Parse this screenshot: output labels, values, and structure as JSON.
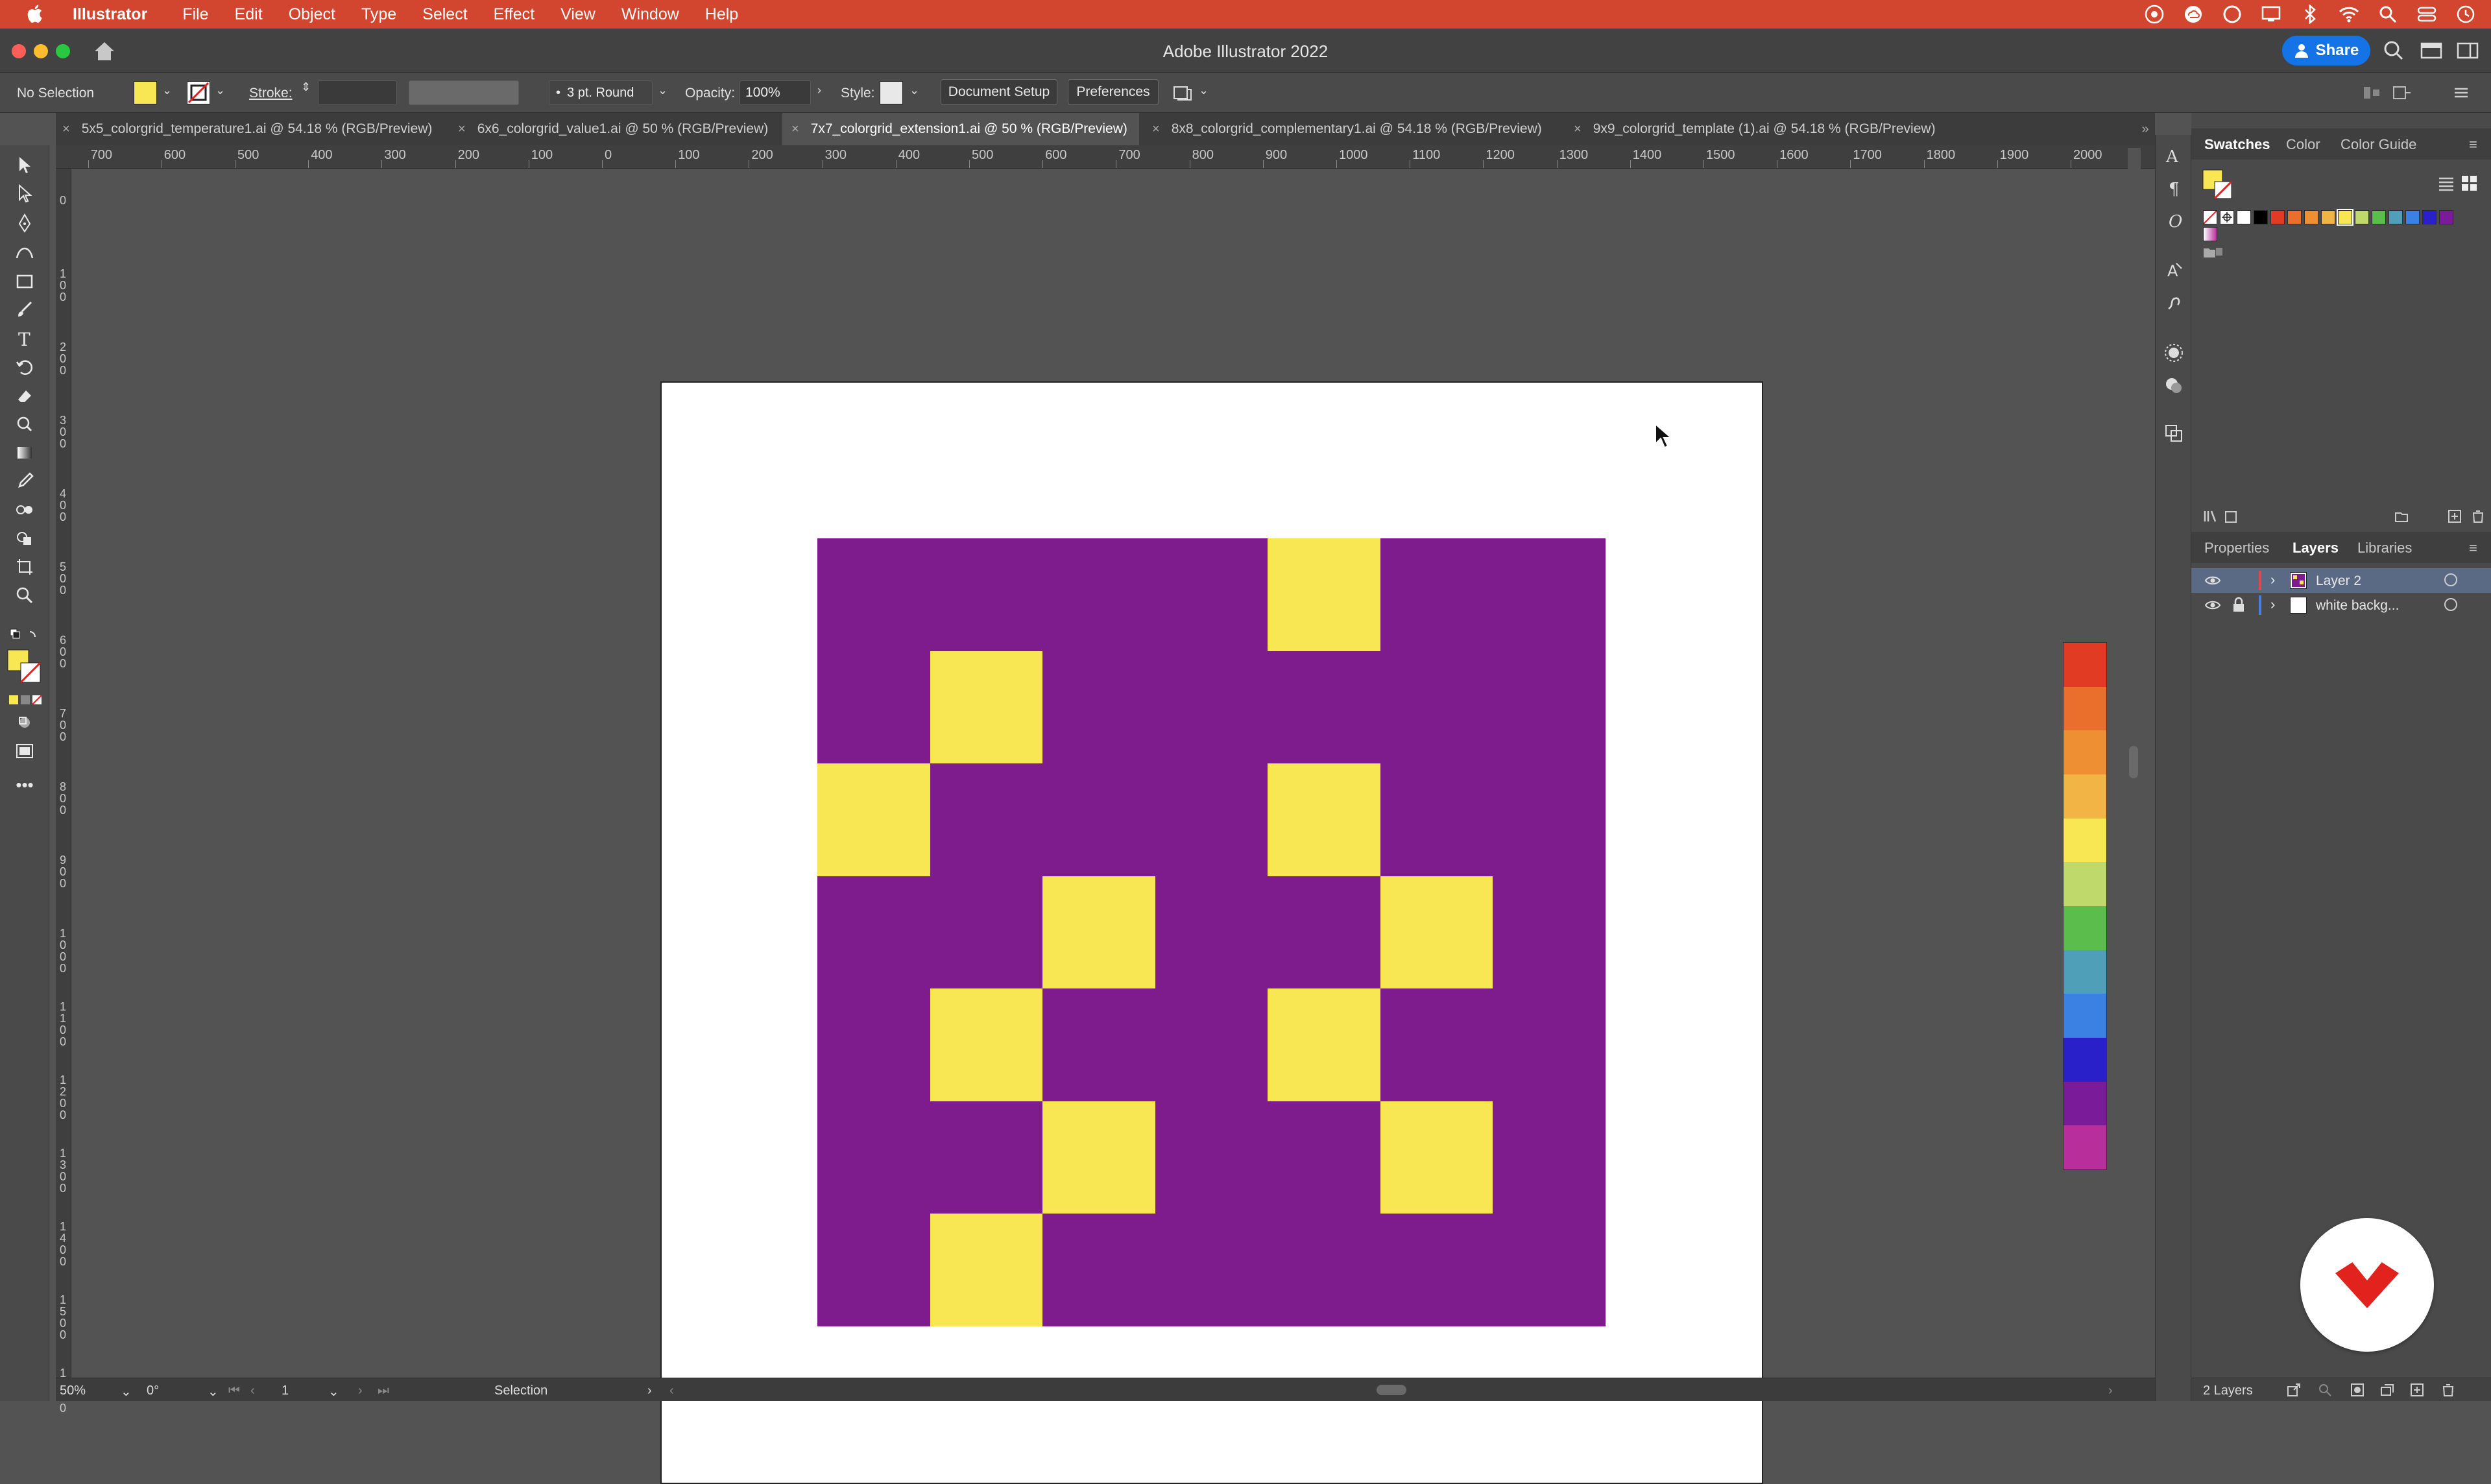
{
  "menubar": {
    "app": "Illustrator",
    "items": [
      "File",
      "Edit",
      "Object",
      "Type",
      "Select",
      "Effect",
      "View",
      "Window",
      "Help"
    ]
  },
  "titlebar": {
    "title": "Adobe Illustrator 2022",
    "share": "Share"
  },
  "control": {
    "selection": "No Selection",
    "fill_color": "#f8e752",
    "stroke_label": "Stroke:",
    "brush": "3 pt. Round",
    "opacity_label": "Opacity:",
    "opacity_value": "100%",
    "style_label": "Style:",
    "document_setup": "Document Setup",
    "preferences": "Preferences"
  },
  "tabs": [
    {
      "label": "5x5_colorgrid_temperature1.ai @ 54.18 % (RGB/Preview)"
    },
    {
      "label": "6x6_colorgrid_value1.ai @ 50 % (RGB/Preview)"
    },
    {
      "label": "7x7_colorgrid_extension1.ai @ 50 % (RGB/Preview)"
    },
    {
      "label": "8x8_colorgrid_complementary1.ai @ 54.18 % (RGB/Preview)"
    },
    {
      "label": "9x9_colorgrid_template (1).ai @ 54.18 % (RGB/Preview)"
    }
  ],
  "ruler_top": [
    "700",
    "600",
    "500",
    "400",
    "300",
    "200",
    "100",
    "0",
    "100",
    "200",
    "300",
    "400",
    "500",
    "600",
    "700",
    "800",
    "900",
    "1000",
    "1100",
    "1200",
    "1300",
    "1400",
    "1500",
    "1600",
    "1700",
    "1800",
    "1900",
    "2000"
  ],
  "ruler_left": [
    "0",
    "100",
    "200",
    "300",
    "400",
    "500",
    "600",
    "700",
    "800",
    "900",
    "1000",
    "1100",
    "1200",
    "1300",
    "1400",
    "1500",
    "1600"
  ],
  "artwork": {
    "grid_size": 7,
    "background": "#7e1b8d",
    "accent": "#f8e752",
    "yellow_cells": [
      [
        0,
        4
      ],
      [
        1,
        1
      ],
      [
        2,
        0
      ],
      [
        2,
        4
      ],
      [
        3,
        2
      ],
      [
        3,
        5
      ],
      [
        4,
        1
      ],
      [
        4,
        4
      ],
      [
        5,
        2
      ],
      [
        5,
        5
      ],
      [
        6,
        1
      ]
    ]
  },
  "colorbar": [
    "#e13b24",
    "#ea6f2c",
    "#ef8f34",
    "#f2b545",
    "#f8e752",
    "#bfd96b",
    "#5bbd4c",
    "#4f9fb9",
    "#3b80e3",
    "#2a20c9",
    "#7a1b9a",
    "#b82f9b"
  ],
  "swatch_row": [
    "#ffffff",
    "#000000",
    "#e13b24",
    "#ea6f2c",
    "#ef8f34",
    "#f2b545",
    "#f8e752",
    "#bfd96b",
    "#5bbd4c",
    "#4f9fb9",
    "#3b80e3",
    "#2a20c9",
    "#7a1b9a"
  ],
  "panels": {
    "top_tabs": [
      "Swatches",
      "Color",
      "Color Guide"
    ],
    "bottom_tabs": [
      "Properties",
      "Layers",
      "Libraries"
    ],
    "layers": [
      {
        "name": "Layer 2",
        "color": "#e14a4a"
      },
      {
        "name": "white backg...",
        "color": "#4a7ee1"
      }
    ],
    "layer_count": "2 Layers"
  },
  "status": {
    "zoom": "50%",
    "rotate": "0°",
    "artboard": "1",
    "tool": "Selection"
  }
}
